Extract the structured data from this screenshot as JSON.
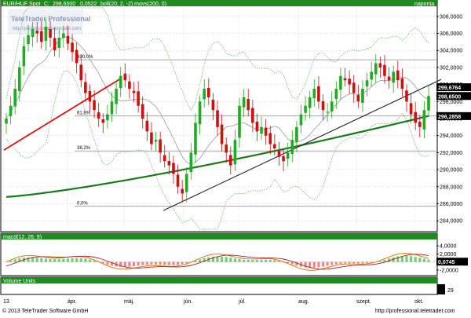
{
  "header": {
    "symbol_text": "EUR/HUF Spot",
    "close_label": "C:",
    "close_value": "298,6500",
    "change_value": "0,0522",
    "indicator_text": "boll(20, 2, -2) movs(200, 0)",
    "period": "naponta"
  },
  "watermark": {
    "brand": "TeleTrader Professional",
    "url": "http://professional.teletrader.com"
  },
  "colors": {
    "bg": "#ffffff",
    "header_bar": "#1f8a1f",
    "candle_up": "#22aa22",
    "candle_down": "#cc1111",
    "ma200": "#1a7a1a",
    "bollinger": "#6db36d",
    "trend_red": "#dd1111",
    "trend_black": "#222222",
    "macd_line": "#e07a1a",
    "signal_line": "#aa2222"
  },
  "footer": {
    "copyright": "© 2013 TeleTrader Software GmbH",
    "url": "http://professional.teletrader.com"
  },
  "chart_data": [
    {
      "type": "candlestick",
      "title": "EUR/HUF Spot",
      "x_labels": [
        "13",
        "ápr.",
        "máj.",
        "jún.",
        "júl.",
        "aug.",
        "szept.",
        "okt."
      ],
      "ylim": [
        283,
        309
      ],
      "y_ticks": [
        284,
        286,
        288,
        290,
        292,
        294,
        296,
        298,
        300,
        302,
        304,
        306,
        308
      ],
      "y_tick_labels": [
        "284,0000",
        "286,0000",
        "288,0000",
        "290,0000",
        "292,0000",
        "294,0000",
        "296,0000",
        "298,0000",
        "300,0000",
        "302,0000",
        "304,0000",
        "306,0000",
        "308,0000"
      ],
      "price_labels": [
        {
          "text": "299,6764",
          "value": 299.68
        },
        {
          "text": "298,6500",
          "value": 298.65
        },
        {
          "text": "296,2858",
          "value": 296.29
        }
      ],
      "fib_levels": [
        {
          "label": "100,0%",
          "value": 302.9
        },
        {
          "label": "61,8%",
          "value": 296.3
        },
        {
          "label": "38,2%",
          "value": 292.2
        },
        {
          "label": "0,0%",
          "value": 285.7
        }
      ],
      "close_series": [
        296.0,
        297.5,
        299.5,
        302.0,
        304.5,
        305.8,
        306.5,
        306.0,
        305.0,
        306.8,
        305.5,
        304.0,
        305.5,
        306.0,
        304.8,
        303.8,
        302.5,
        300.5,
        299.0,
        298.0,
        297.0,
        296.0,
        295.5,
        296.5,
        298.0,
        299.5,
        301.0,
        300.5,
        299.5,
        299.0,
        297.5,
        296.0,
        294.5,
        293.0,
        293.5,
        292.0,
        291.0,
        290.5,
        289.5,
        288.0,
        287.2,
        289.5,
        292.0,
        295.5,
        298.0,
        299.5,
        298.5,
        297.0,
        295.0,
        293.0,
        292.0,
        290.5,
        293.5,
        297.5,
        298.5,
        297.0,
        295.5,
        294.5,
        295.0,
        294.0,
        293.0,
        292.5,
        291.5,
        291.0,
        292.0,
        293.5,
        295.0,
        296.5,
        297.5,
        298.5,
        299.5,
        298.0,
        297.0,
        296.8,
        298.0,
        299.5,
        301.0,
        300.5,
        300.0,
        299.0,
        298.0,
        299.5,
        300.5,
        301.5,
        302.5,
        302.0,
        301.0,
        300.5,
        301.5,
        300.5,
        299.5,
        298.0,
        296.5,
        295.5,
        295.0,
        297.0,
        298.65
      ]
    },
    {
      "type": "macd",
      "title": "macd(12, 26, 9)",
      "ylim": [
        -3,
        5
      ],
      "y_ticks": [
        4,
        2,
        0,
        -2
      ],
      "y_tick_labels": [
        "4,0000",
        "2,0000",
        "0,0000",
        "-2,0000"
      ],
      "last_value_label": "0,0745"
    },
    {
      "type": "volume",
      "title": "Volume Units",
      "y_tick_labels": [
        "29"
      ]
    }
  ]
}
